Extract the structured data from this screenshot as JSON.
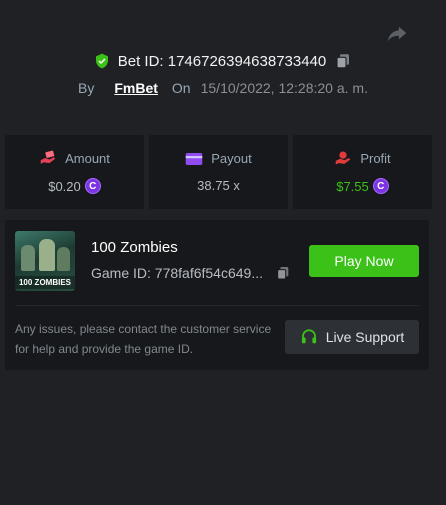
{
  "header": {
    "share_icon": "share-arrow-icon",
    "bet_label": "Bet ID: 1746726394638733440",
    "by_label": "By",
    "username": "FmBet",
    "on_label": "On",
    "datetime": "15/10/2022, 12:28:20 a. m."
  },
  "stats": {
    "amount": {
      "label": "Amount",
      "value": "$0.20",
      "icon": "money-hand-icon"
    },
    "payout": {
      "label": "Payout",
      "value": "38.75 x",
      "icon": "card-icon"
    },
    "profit": {
      "label": "Profit",
      "value": "$7.55",
      "icon": "profit-hand-icon"
    },
    "coin_symbol": "C"
  },
  "game": {
    "title": "100 Zombies",
    "id_label": "Game ID: 778faf6f54c649...",
    "thumbnail_text": "100 ZOMBIES",
    "play_label": "Play Now"
  },
  "support": {
    "notice": "Any issues, please contact the customer service for help and provide the game ID.",
    "button_label": "Live Support"
  },
  "colors": {
    "background": "#1f2125",
    "card": "#17181b",
    "green": "#3bc117",
    "coin": "#7d33e6"
  }
}
